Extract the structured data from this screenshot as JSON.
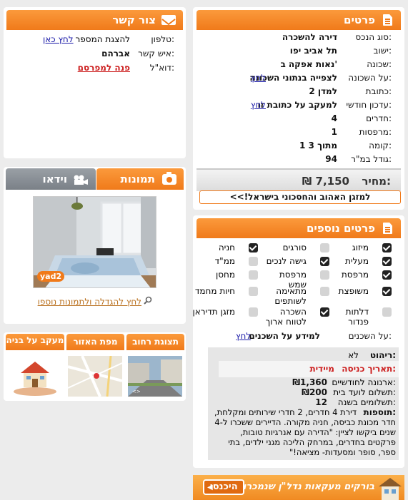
{
  "details": {
    "title": "פרטים",
    "rows": [
      {
        "label": "סוג הנכס:",
        "value": "דירה להשכרה"
      },
      {
        "label": "ישוב:",
        "value": "תל אביב יפו"
      },
      {
        "label": "שכונה:",
        "value": "נאות אפקה ב'"
      },
      {
        "label": "על השכונה:",
        "value": "לצפייה בנתוני השכונה",
        "link": "לחץ"
      },
      {
        "label": "כתובת:",
        "value": "למדן 2"
      },
      {
        "label": "עדכון חודשי:",
        "value": "למעקב על כתובת זו",
        "link": "לחץ"
      },
      {
        "label": "חדרים:",
        "value": "4"
      },
      {
        "label": "מרפסות:",
        "value": "1"
      },
      {
        "label": "קומה:",
        "value": "1 מתוך 3"
      },
      {
        "label": "גודל במ\"ר:",
        "value": "94"
      }
    ],
    "price_label": "מחיר:",
    "price_value": "7,150 ₪",
    "promo_link": "למזגן האהוב והחסכוני בישראל!>>"
  },
  "contact": {
    "title": "צור קשר",
    "phone_label": "טלפון:",
    "phone_text": "להצגת המספר",
    "phone_link": "לחץ כאן",
    "person_label": "איש קשר:",
    "person_value": "אברהם",
    "email_label": "דוא\"ל:",
    "email_link": "פנה למפרסם"
  },
  "media": {
    "tab_photos": "תמונות",
    "tab_video": "וידאו",
    "watermark": "yad2",
    "enlarge_link": "לחץ להגדלה ולתמונות נוספו"
  },
  "maps": {
    "tab_street": "תצוגת רחוב",
    "tab_area": "מפת האזור",
    "tab_track": "מעקב על בניה"
  },
  "more_details": {
    "title": "פרטים נוספים",
    "features": [
      {
        "label": "מיזוג",
        "checked": true
      },
      {
        "label": "סורגים",
        "checked": false
      },
      {
        "label": "חניה",
        "checked": true
      },
      {
        "label": "מעלית",
        "checked": true
      },
      {
        "label": "גישה לנכים",
        "checked": true
      },
      {
        "label": "ממ\"ד",
        "checked": false
      },
      {
        "label": "מרפסת",
        "checked": true
      },
      {
        "label": "מרפסת שמש",
        "checked": false
      },
      {
        "label": "מחסן",
        "checked": false
      },
      {
        "label": "משופצת",
        "checked": true
      },
      {
        "label": "מתאימה לשותפים",
        "checked": false
      },
      {
        "label": "חיות מחמד",
        "checked": false
      },
      {
        "label": "דלתות פנדור",
        "checked": false
      },
      {
        "label": "השכרה לטווח ארוך",
        "checked": true
      },
      {
        "label": "מזגן תדיראן",
        "checked": false
      }
    ],
    "tenants_label": "על השכנים:",
    "tenants_value": "למידע על השכנים",
    "tenants_link": "לחץ",
    "furniture_label": "ריהוט:",
    "furniture_value": "לא",
    "entry_label": "תאריך כניסה:",
    "entry_value": "מיידית",
    "arnona_label": "ארנונה לחודשיים:",
    "arnona_value": "₪1,360",
    "vaad_label": "תשלום לועד בית:",
    "vaad_value": "₪200",
    "payments_label": "תשלומים בשנה:",
    "payments_value": "12",
    "extras_label": "תוספות:",
    "extras_text": "דירת 4 חדרים, 2 חדרי שירותים ומקלחת, חדר מכונת כביסה, חניה מקורה. הדיירים ששכרו ל-4 שנים ביקשו לציין: \"הדירה עם אנרגיות טובות, פרקטים בחדרים, במרחק הליכה מגני ילדים, בתי ספר, סופר ומסעדות- מציאה!\""
  },
  "banner": {
    "text": "בורקים מעקאות נדל\"ן שנמכרו בשכונה",
    "button": "היכנסו"
  },
  "colors": {
    "orange": "#f07a1a",
    "gray_tab": "#8a8f95",
    "link": "#1a1aa8",
    "red": "#cc1d1d",
    "brown": "#b96f1c"
  }
}
